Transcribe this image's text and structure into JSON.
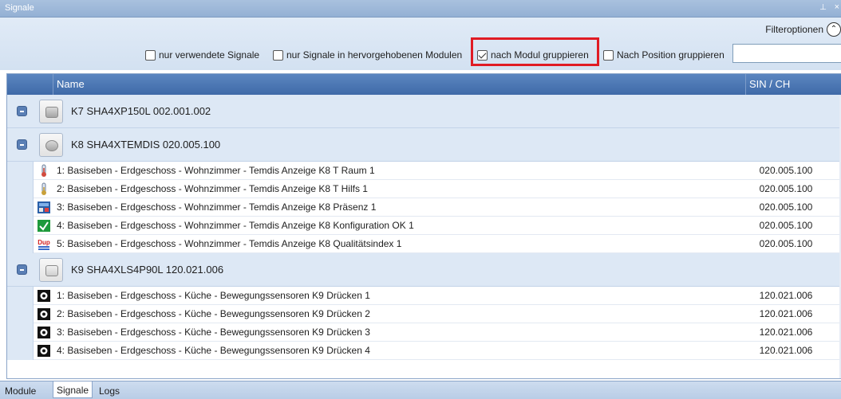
{
  "window": {
    "title": "Signale",
    "pin_glyph": " ᴜ",
    "close_glyph": "×"
  },
  "filter": {
    "options_label": "Filteroptionen",
    "checkboxes": [
      {
        "label": "nur verwendete Signale",
        "checked": false
      },
      {
        "label": "nur Signale in hervorgehobenen Modulen",
        "checked": false
      },
      {
        "label": "nach Modul gruppieren",
        "checked": true
      },
      {
        "label": "Nach Position gruppieren",
        "checked": false
      }
    ],
    "search_value": ""
  },
  "grid": {
    "columns": {
      "name": "Name",
      "sin": "SIN / CH"
    },
    "groups": [
      {
        "label": "K7 SHA4XP150L   002.001.002",
        "signals": []
      },
      {
        "label": "K8 SHA4XTEMDIS   020.005.100",
        "signals": [
          {
            "icon": "thermometer-icon",
            "name": "1: Basiseben - Erdgeschoss - Wohnzimmer - Temdis Anzeige K8 T Raum 1",
            "sin": "020.005.100"
          },
          {
            "icon": "thermometer-icon",
            "name": "2: Basiseben - Erdgeschoss - Wohnzimmer - Temdis Anzeige K8 T Hilfs 1",
            "sin": "020.005.100"
          },
          {
            "icon": "presence-icon",
            "name": "3: Basiseben - Erdgeschoss - Wohnzimmer - Temdis Anzeige K8 Präsenz 1",
            "sin": "020.005.100"
          },
          {
            "icon": "config-ok-icon",
            "name": "4: Basiseben - Erdgeschoss - Wohnzimmer - Temdis Anzeige K8 Konfiguration OK 1",
            "sin": "020.005.100"
          },
          {
            "icon": "dup-icon",
            "icon_text": "Dup",
            "name": "5: Basiseben - Erdgeschoss - Wohnzimmer - Temdis Anzeige K8 Qualitätsindex 1",
            "sin": "020.005.100"
          }
        ]
      },
      {
        "label": "K9 SHA4XLS4P90L   120.021.006",
        "signals": [
          {
            "icon": "push-button-icon",
            "name": "1: Basiseben - Erdgeschoss - Küche - Bewegungssensoren K9 Drücken 1",
            "sin": "120.021.006"
          },
          {
            "icon": "push-button-icon",
            "name": "2: Basiseben - Erdgeschoss - Küche - Bewegungssensoren K9 Drücken 2",
            "sin": "120.021.006"
          },
          {
            "icon": "push-button-icon",
            "name": "3: Basiseben - Erdgeschoss - Küche - Bewegungssensoren K9 Drücken 3",
            "sin": "120.021.006"
          },
          {
            "icon": "push-button-icon",
            "name": "4: Basiseben - Erdgeschoss - Küche - Bewegungssensoren K9 Drücken 4",
            "sin": "120.021.006"
          }
        ]
      }
    ]
  },
  "tabs": [
    {
      "label": "Module",
      "active": false
    },
    {
      "label": "Signale",
      "active": true
    },
    {
      "label": "Logs",
      "active": false
    }
  ]
}
